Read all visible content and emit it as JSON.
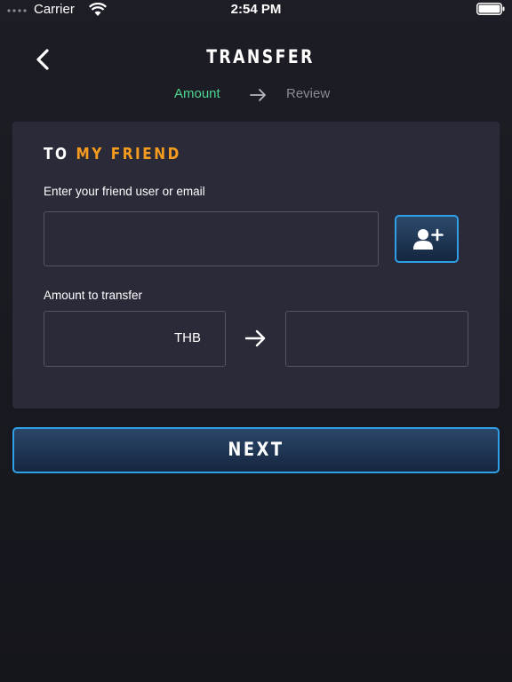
{
  "status_bar": {
    "carrier": "Carrier",
    "time": "2:54 PM"
  },
  "header": {
    "title": "TRANSFER",
    "back_icon": "chevron-left-icon"
  },
  "steps": {
    "current": "Amount",
    "next": "Review",
    "current_color": "#4fd691",
    "inactive_color": "#8a8a92"
  },
  "card": {
    "title_prefix": "TO",
    "title_highlight": "MY FRIEND",
    "highlight_color": "#f59c1f",
    "friend_label": "Enter your friend user or email",
    "friend_value": "",
    "add_friend_icon": "add-user-icon",
    "amount_label": "Amount to transfer",
    "amount_value": "",
    "currency": "THB",
    "converted_value": ""
  },
  "next_button": {
    "label": "NEXT"
  },
  "colors": {
    "accent_border": "#2f9fe8",
    "background": "#1a1a22",
    "card": "#2a2a38"
  }
}
